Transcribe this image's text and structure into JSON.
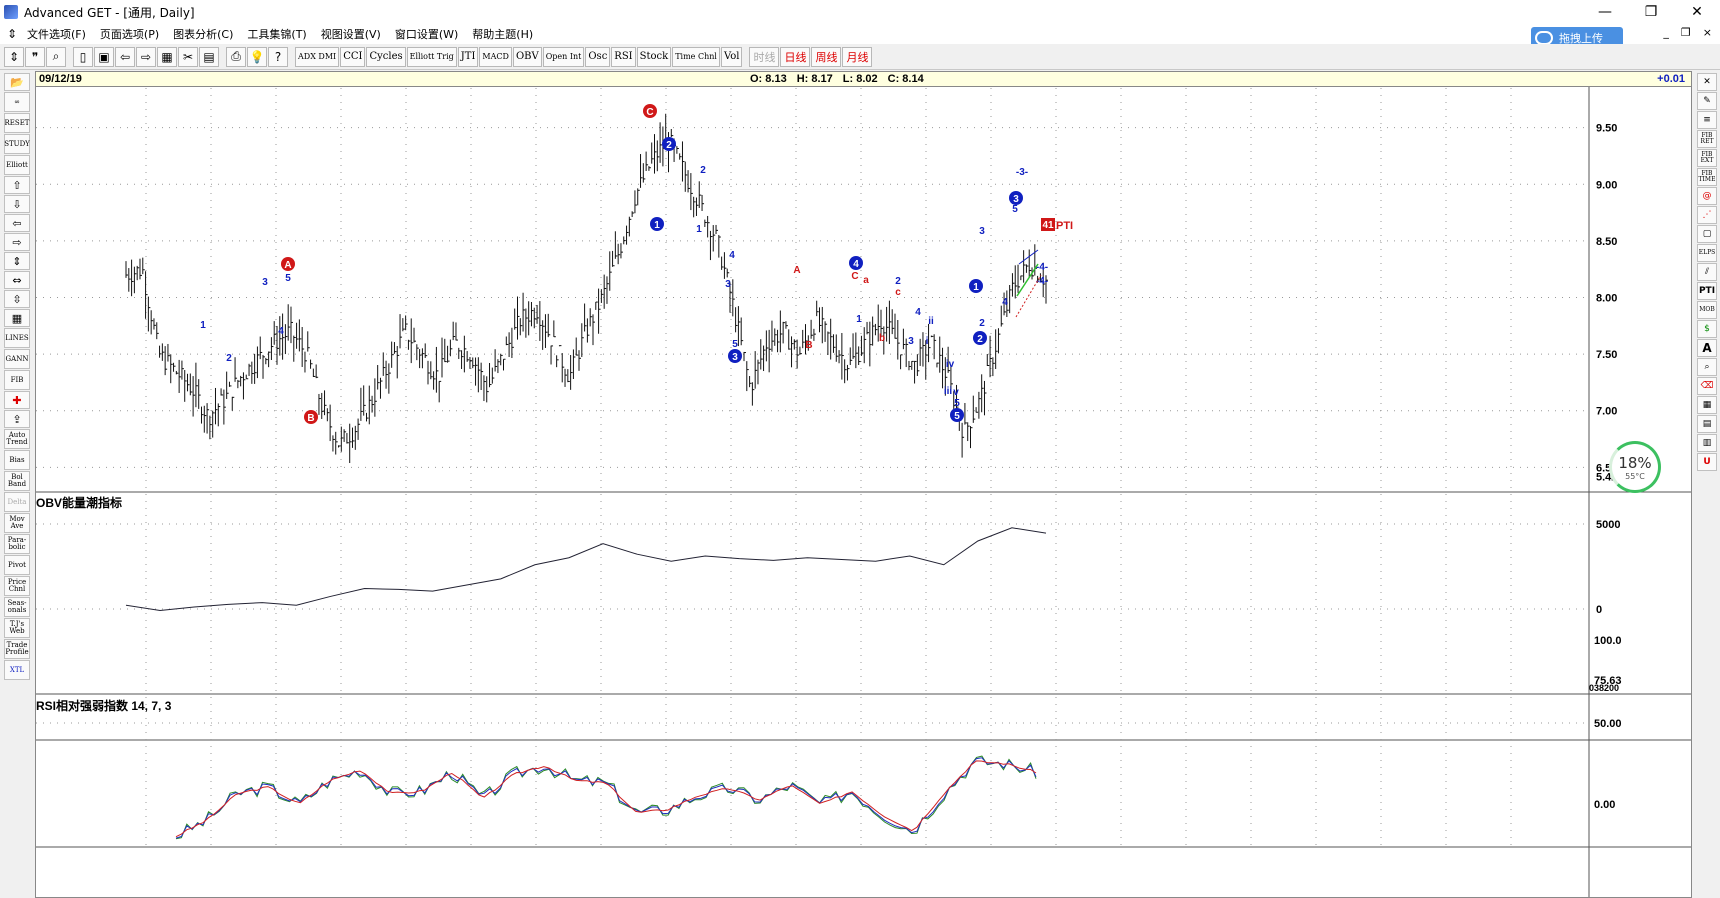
{
  "window": {
    "title": "Advanced GET - [通用, Daily]",
    "controls": [
      "—",
      "❐",
      "✕"
    ]
  },
  "menu": {
    "items": [
      "文件选项(F)",
      "页面选项(P)",
      "图表分析(C)",
      "工具集锦(T)",
      "视图设置(V)",
      "窗口设置(W)",
      "帮助主题(H)"
    ],
    "mdi_controls": [
      "_",
      "❐",
      "×"
    ]
  },
  "upload_button": {
    "label": "拖拽上传"
  },
  "toolbar": {
    "text_buttons": [
      "ADX DMI",
      "CCI",
      "Cycles",
      "Elliott Trig",
      "JTI",
      "MACD",
      "OBV",
      "Open Int",
      "Osc",
      "RSI",
      "Stock",
      "Time Chnl",
      "Vol"
    ],
    "periods": [
      "时线",
      "日线",
      "周线",
      "月线"
    ]
  },
  "left_tools": [
    "RESET",
    "STUDY",
    "Elliott",
    "LINES",
    "GANN",
    "FIB",
    "Auto Trend",
    "Bias",
    "Bol Band",
    "Delta",
    "Mov Ave",
    "Para-bolic",
    "Pivot",
    "Price Chnl",
    "Seas-onals",
    "T.J's Web",
    "Trade Profile",
    "XTL"
  ],
  "right_tools": [
    "FIB RET",
    "FIB EXT",
    "FIB TIME",
    "ELPS",
    "PTI",
    "MOB",
    "A"
  ],
  "info": {
    "date": "09/12/19",
    "open": "O: 8.13",
    "high": "H: 8.17",
    "low": "L: 8.02",
    "close": "C: 8.14",
    "change": "+0.01"
  },
  "price_axis": {
    "ticks": [
      "9.50",
      "9.00",
      "8.50",
      "8.00",
      "7.50",
      "7.00",
      "6.50"
    ],
    "last": "5.42"
  },
  "obv": {
    "label": "OBV能量潮指标",
    "ticks": [
      "5000",
      "0"
    ],
    "bottom_tag": "038200"
  },
  "rsi": {
    "label": "RSI相对强弱指数 14, 7, 3",
    "ticks": [
      "100.0",
      "75.63",
      "50.00",
      "0.00"
    ]
  },
  "pti": {
    "value": "41",
    "label": "PTI"
  },
  "gauge": {
    "percent": "18%",
    "temp": "55°C"
  },
  "wave_labels": {
    "circled_red": [
      "A",
      "B",
      "C"
    ],
    "circled_blue": [
      "1",
      "2",
      "3",
      "4",
      "5",
      "3",
      "1",
      "2",
      "3"
    ],
    "small": [
      "1",
      "2",
      "3",
      "4",
      "5",
      "2",
      "1",
      "4",
      "3",
      "5",
      "A",
      "B",
      "C",
      "a",
      "b",
      "c",
      "1",
      "2",
      "3",
      "4",
      "i",
      "ii",
      "iii",
      "iv",
      "v",
      "5",
      "3",
      "5",
      "4",
      "2",
      "-3-",
      "-4-",
      "-4-"
    ]
  },
  "chart_data": {
    "type": "line",
    "price_range": [
      6.3,
      9.85
    ],
    "close_path": [
      8.2,
      8.25,
      7.5,
      7.35,
      7.2,
      6.95,
      7.1,
      7.3,
      7.45,
      7.6,
      7.7,
      7.5,
      7.0,
      6.7,
      6.85,
      7.1,
      7.4,
      7.7,
      7.5,
      7.3,
      7.6,
      7.5,
      7.2,
      7.5,
      7.8,
      7.9,
      7.6,
      7.3,
      7.7,
      8.0,
      8.4,
      8.9,
      9.2,
      9.4,
      9.1,
      8.8,
      8.5,
      7.9,
      7.2,
      7.6,
      7.7,
      7.5,
      7.8,
      7.6,
      7.4,
      7.6,
      7.8,
      7.6,
      7.4,
      7.6,
      7.3,
      6.8,
      7.1,
      7.6,
      8.1,
      8.3,
      8.15
    ],
    "obv_path": [
      0.2,
      -0.4,
      0.0,
      0.3,
      0.5,
      0.2,
      1.2,
      2.1,
      2.0,
      1.8,
      2.5,
      3.2,
      4.8,
      5.6,
      7.2,
      6.0,
      5.2,
      5.8,
      5.5,
      5.3,
      5.6,
      5.4,
      5.2,
      5.8,
      4.8,
      7.5,
      9.0,
      8.4
    ],
    "rsi_path": [
      10,
      25,
      50,
      56,
      40,
      62,
      72,
      50,
      52,
      70,
      45,
      68,
      76,
      62,
      60,
      32,
      35,
      48,
      55,
      44,
      58,
      40,
      52,
      30,
      15,
      50,
      80,
      78,
      70
    ]
  }
}
